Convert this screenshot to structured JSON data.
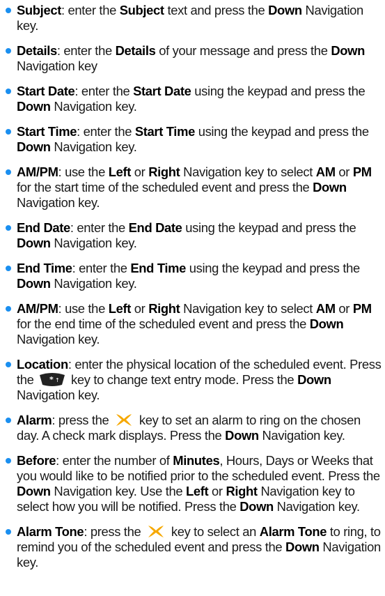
{
  "colors": {
    "bullet": "#1a8ff0",
    "x_key": "#f6a800",
    "star_key": "#222222"
  },
  "items": [
    {
      "label": "Subject",
      "s1": ": enter the ",
      "b1": "Subject",
      "s2": " text and press the ",
      "b2": "Down",
      "s3": " Navigation key."
    },
    {
      "label": "Details",
      "s1": ": enter the ",
      "b1": "Details",
      "s2": " of your message and press the ",
      "b2": "Down",
      "s3": " Navigation key"
    },
    {
      "label": "Start Date",
      "s1": ": enter the ",
      "b1": "Start Date",
      "s2": " using the keypad and press the ",
      "b2": "Down",
      "s3": " Navigation key."
    },
    {
      "label": "Start Time",
      "s1": ": enter the ",
      "b1": "Start Time",
      "s2": " using the keypad and press the ",
      "b2": "Down",
      "s3": " Navigation key."
    },
    {
      "label": "AM/PM",
      "s1": ": use the ",
      "b1": "Left",
      "s2": " or ",
      "b2": "Right",
      "s3": " Navigation key to select ",
      "b3": "AM",
      "s4": " or ",
      "b4": "PM",
      "s5": " for the start time of the scheduled event and press the ",
      "b5": "Down",
      "s6": " Navigation key."
    },
    {
      "label": "End Date",
      "s1": ": enter the ",
      "b1": "End Date",
      "s2": " using the keypad and press the ",
      "b2": "Down",
      "s3": " Navigation key."
    },
    {
      "label": "End Time",
      "s1": ": enter the ",
      "b1": "End Time",
      "s2": " using the keypad and press the ",
      "b2": "Down",
      "s3": " Navigation key."
    },
    {
      "label": "AM/PM",
      "s1": ": use the ",
      "b1": "Left",
      "s2": " or ",
      "b2": "Right",
      "s3": " Navigation key to select ",
      "b3": "AM",
      "s4": " or ",
      "b4": "PM",
      "s5": " for the end time of the scheduled event and press the ",
      "b5": "Down",
      "s6": " Navigation key."
    },
    {
      "label": "Location",
      "s1": ": enter the physical location of the scheduled event. Press the ",
      "s2": " key to change text entry mode. Press the ",
      "b1": "Down",
      "s3": " Navigation key."
    },
    {
      "label": "Alarm",
      "s1": ": press the ",
      "s2": " key to set an alarm to ring on the chosen day. A check mark displays. Press the ",
      "b1": "Down",
      "s3": " Navigation key."
    },
    {
      "label": "Before",
      "s1": ": enter the number of ",
      "b1": "Minutes",
      "s2": ", Hours, Days or Weeks that you would like to be notified prior to the scheduled event. Press the ",
      "b2": "Down",
      "s3": " Navigation key. Use the ",
      "b3": "Left",
      "s4": " or ",
      "b4": "Right",
      "s5": " Navigation key to select how you will be notified. Press the ",
      "b5": "Down",
      "s6": " Navigation key."
    },
    {
      "label": "Alarm Tone",
      "s1": ": press the ",
      "s2": " key to select an ",
      "b1": "Alarm Tone",
      "s3": " to ring, to remind you of the scheduled event and press the ",
      "b2": "Down",
      "s4": " Navigation key."
    }
  ]
}
